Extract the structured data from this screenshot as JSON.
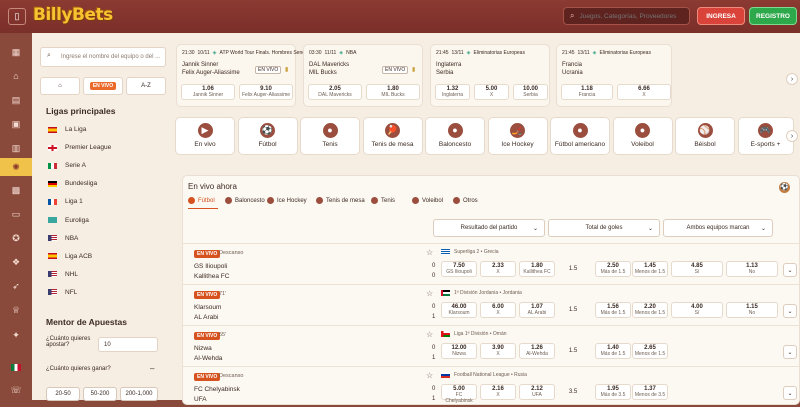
{
  "header": {
    "logo": "BillyBets",
    "search_placeholder": "Juegos, Categorías, Proveedores",
    "login_label": "INGRESA",
    "register_label": "REGISTRO"
  },
  "sidebar": {
    "filter_placeholder": "Ingrese el nombre del equipo o del ...",
    "seg_live": "EN VIVO",
    "seg_az": "A-Z",
    "leagues_title": "Ligas principales",
    "leagues": [
      {
        "name": "La Liga",
        "flag": "es"
      },
      {
        "name": "Premier League",
        "flag": "en"
      },
      {
        "name": "Serie A",
        "flag": "it"
      },
      {
        "name": "Bundesliga",
        "flag": "de"
      },
      {
        "name": "Liga 1",
        "flag": "fr"
      },
      {
        "name": "Euroliga",
        "flag": "eu"
      },
      {
        "name": "NBA",
        "flag": "us"
      },
      {
        "name": "Liga ACB",
        "flag": "es"
      },
      {
        "name": "NHL",
        "flag": "us"
      },
      {
        "name": "NFL",
        "flag": "us"
      }
    ],
    "mentor_title": "Mentor de Apuestas",
    "q_bet": "¿Cuánto quieres apostar?",
    "bet_value": "10",
    "q_win": "¿Cuánto quieres ganar?",
    "chips": [
      "20-50",
      "50-200",
      "200-1,000"
    ]
  },
  "highlights": [
    {
      "time": "21:30",
      "date": "10/11",
      "comp": "ATP World Tour Finals. Hombres Sencillos",
      "t1": "Jannik Sinner",
      "t2": "Felix Auger-Aliassime",
      "badge": "EN VIVO",
      "o1": {
        "v": "1.06",
        "l": "Jannik Sinner"
      },
      "o2": {
        "v": "9.10",
        "l": "Felix Auger-Aliassime"
      }
    },
    {
      "time": "03:30",
      "date": "11/11",
      "comp": "NBA",
      "t1": "DAL Mavericks",
      "t2": "MIL Bucks",
      "badge": "EN VIVO",
      "o1": {
        "v": "2.05",
        "l": "DAL Mavericks"
      },
      "o2": {
        "v": "1.80",
        "l": "MIL Bucks"
      }
    },
    {
      "time": "21:45",
      "date": "13/11",
      "comp": "Eliminatorias Europeas",
      "t1": "Inglaterra",
      "t2": "Serbia",
      "o1": {
        "v": "1.32",
        "l": "Inglaterra"
      },
      "ox": {
        "v": "5.00",
        "l": "X"
      },
      "o2": {
        "v": "10.00",
        "l": "Serbia"
      }
    },
    {
      "time": "21:45",
      "date": "13/11",
      "comp": "Eliminatorias Europeas",
      "t1": "Francia",
      "t2": "Ucrania",
      "o1": {
        "v": "1.18",
        "l": "Francia"
      },
      "ox": {
        "v": "6.66",
        "l": "X"
      }
    }
  ],
  "sports": [
    {
      "label": "En vivo",
      "icon": "▶"
    },
    {
      "label": "Fútbol",
      "icon": "⚽"
    },
    {
      "label": "Tenis",
      "icon": "●"
    },
    {
      "label": "Tenis de mesa",
      "icon": "🏓"
    },
    {
      "label": "Baloncesto",
      "icon": "●"
    },
    {
      "label": "Ice Hockey",
      "icon": "🏒"
    },
    {
      "label": "Fútbol americano",
      "icon": "●"
    },
    {
      "label": "Voleibol",
      "icon": "●"
    },
    {
      "label": "Béisbol",
      "icon": "⚾"
    },
    {
      "label": "E-sports +",
      "icon": "🎮"
    }
  ],
  "live": {
    "title": "En vivo ahora",
    "tabs": [
      "Fútbol",
      "Baloncesto",
      "Ice Hockey",
      "Tenis de mesa",
      "Tenis",
      "Voleibol",
      "Otros"
    ],
    "dropdowns": [
      "Resultado del partido",
      "Total de goles",
      "Ambos equipos marcan"
    ],
    "rows": [
      {
        "badge": "EN VIVO",
        "meta": "Descanso",
        "t1": "GS Ilioupoli",
        "t2": "Kallithea FC",
        "s1": "0",
        "s2": "0",
        "comp": "Superliga 2 • Grecia",
        "flag": "gr",
        "odds": [
          {
            "v": "7.50",
            "l": "GS Ilioupoli"
          },
          {
            "v": "2.33",
            "l": "X"
          },
          {
            "v": "1.80",
            "l": "Kallithea FC"
          }
        ],
        "line": "1.5",
        "totals": [
          {
            "v": "2.50",
            "l": "Más de 1.5"
          },
          {
            "v": "1.45",
            "l": "Menos de 1.5"
          }
        ],
        "btts": [
          {
            "v": "4.85",
            "l": "Sí"
          },
          {
            "v": "1.13",
            "l": "No"
          }
        ]
      },
      {
        "badge": "EN VIVO",
        "meta": "71'",
        "t1": "Klarsoum",
        "t2": "AL Arabi",
        "s1": "0",
        "s2": "1",
        "comp": "1ª División Jordania • Jordania",
        "flag": "jo",
        "odds": [
          {
            "v": "46.00",
            "l": "Klarsoum"
          },
          {
            "v": "6.00",
            "l": "X"
          },
          {
            "v": "1.07",
            "l": "AL Arabi"
          }
        ],
        "line": "1.5",
        "totals": [
          {
            "v": "1.56",
            "l": "Más de 1.5"
          },
          {
            "v": "2.20",
            "l": "Menos de 1.5"
          }
        ],
        "btts": [
          {
            "v": "4.00",
            "l": "Sí"
          },
          {
            "v": "1.15",
            "l": "No"
          }
        ]
      },
      {
        "badge": "EN VIVO",
        "meta": "55'",
        "t1": "Nizwa",
        "t2": "Al-Wehda",
        "s1": "0",
        "s2": "1",
        "comp": "Liga 1ª División • Omán",
        "flag": "om",
        "odds": [
          {
            "v": "12.00",
            "l": "Nizwa"
          },
          {
            "v": "3.90",
            "l": "X"
          },
          {
            "v": "1.26",
            "l": "Al-Wehda"
          }
        ],
        "line": "1.5",
        "totals": [
          {
            "v": "1.40",
            "l": "Más de 1.5"
          },
          {
            "v": "2.65",
            "l": "Menos de 1.5"
          }
        ],
        "btts": []
      },
      {
        "badge": "EN VIVO",
        "meta": "Descanso",
        "t1": "FC Chelyabinsk",
        "t2": "UFA",
        "s1": "0",
        "s2": "1",
        "comp": "Football National League • Rusia",
        "flag": "ru",
        "odds": [
          {
            "v": "5.00",
            "l": "FC Chelyabinsk"
          },
          {
            "v": "2.16",
            "l": "X"
          },
          {
            "v": "2.12",
            "l": "UFA"
          }
        ],
        "line": "3.5",
        "totals": [
          {
            "v": "1.95",
            "l": "Más de 3.5"
          },
          {
            "v": "1.37",
            "l": "Menos de 3.5"
          }
        ],
        "btts": []
      }
    ]
  },
  "colors": {
    "brand": "#8c3a32",
    "accent": "#d6531f",
    "login": "#d94339",
    "register": "#2da84a",
    "sidebar_active": "#f1c24a"
  }
}
